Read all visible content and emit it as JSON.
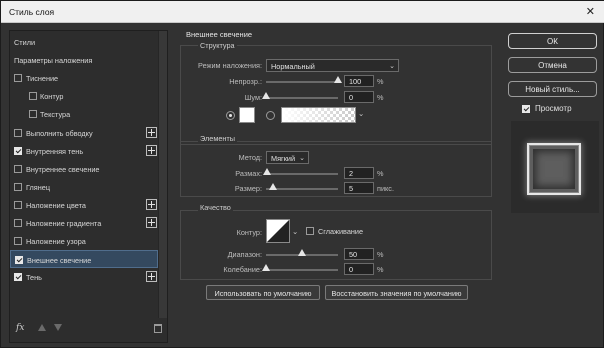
{
  "window": {
    "title": "Стиль слоя",
    "close_glyph": "✕"
  },
  "styles_panel": {
    "items": [
      {
        "label": "Стили",
        "type": "plain"
      },
      {
        "label": "Параметры наложения",
        "type": "plain"
      },
      {
        "label": "Тиснение",
        "type": "check",
        "checked": false,
        "plus": false
      },
      {
        "label": "Контур",
        "type": "sub",
        "checked": false
      },
      {
        "label": "Текстура",
        "type": "sub",
        "checked": false
      },
      {
        "label": "Выполнить обводку",
        "type": "check",
        "checked": false,
        "plus": true
      },
      {
        "label": "Внутренняя тень",
        "type": "check",
        "checked": true,
        "plus": true
      },
      {
        "label": "Внутреннее свечение",
        "type": "check",
        "checked": false,
        "plus": false
      },
      {
        "label": "Глянец",
        "type": "check",
        "checked": false,
        "plus": false
      },
      {
        "label": "Наложение цвета",
        "type": "check",
        "checked": false,
        "plus": true
      },
      {
        "label": "Наложение градиента",
        "type": "check",
        "checked": false,
        "plus": true
      },
      {
        "label": "Наложение узора",
        "type": "check",
        "checked": false,
        "plus": false
      },
      {
        "label": "Внешнее свечение",
        "type": "check",
        "checked": true,
        "plus": false,
        "active": true
      },
      {
        "label": "Тень",
        "type": "check",
        "checked": true,
        "plus": true
      }
    ],
    "fx_label": "fx"
  },
  "outer_glow": {
    "title": "Внешнее свечение",
    "structure": {
      "label": "Структура",
      "blend_mode_label": "Режим наложения:",
      "blend_mode_value": "Нормальный",
      "opacity_label": "Непрозр.:",
      "opacity_value": "100",
      "opacity_unit": "%",
      "opacity_level": 1.0,
      "noise_label": "Шум:",
      "noise_value": "0",
      "noise_unit": "%",
      "noise_level": 0.0,
      "glow_color": "#ffffff"
    },
    "elements": {
      "label": "Элементы",
      "method_label": "Метод:",
      "method_value": "Мягкий",
      "spread_label": "Размах:",
      "spread_value": "2",
      "spread_unit": "%",
      "spread_level": 0.02,
      "size_label": "Размер:",
      "size_value": "5",
      "size_unit": "пикс."
    },
    "quality": {
      "label": "Качество",
      "contour_label": "Контур:",
      "antialias_label": "Сглаживание",
      "antialias_checked": false,
      "range_label": "Диапазон:",
      "range_value": "50",
      "range_unit": "%",
      "range_level": 0.5,
      "jitter_label": "Колебание:",
      "jitter_value": "0",
      "jitter_unit": "%",
      "jitter_level": 0.0
    },
    "make_default_label": "Использовать по умолчанию",
    "reset_default_label": "Восстановить значения по умолчанию"
  },
  "actions": {
    "ok_label": "ОК",
    "cancel_label": "Отмена",
    "new_style_label": "Новый стиль...",
    "preview_label": "Просмотр",
    "preview_checked": true
  }
}
